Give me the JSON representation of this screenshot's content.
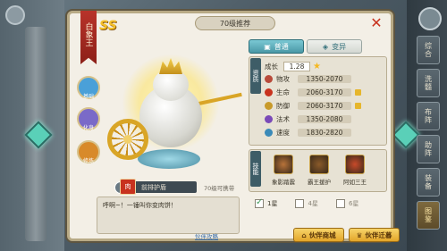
{
  "window": {
    "title": "70级推荐",
    "close_symbol": "✕"
  },
  "hero": {
    "name": "白象王",
    "rank": "SS",
    "skills_left": [
      {
        "label": "基础",
        "icon": "shield-icon",
        "color": "#4aa0d8"
      },
      {
        "label": "化身",
        "icon": "avatar-icon",
        "color": "#7a6ac8"
      },
      {
        "label": "修炼",
        "icon": "flame-icon",
        "color": "#d88a2a"
      }
    ],
    "position_tag": "肉",
    "role_label": "前排护盾",
    "level_note": "70级可携带",
    "quote": "呼啊~！一锤叫你变肉饼！",
    "quote_link": "伙伴攻略"
  },
  "tabs": [
    {
      "label": "普通",
      "icon": "book-icon"
    },
    {
      "label": "变异",
      "icon": "mutation-icon"
    }
  ],
  "stats": {
    "section_label": "资质",
    "growth_label": "成长",
    "growth_value": "1.28",
    "rows": [
      {
        "label": "物攻",
        "value": "1350-2070",
        "color": "#b84a3a",
        "mark": false
      },
      {
        "label": "生命",
        "value": "2060-3170",
        "color": "#c8321e",
        "mark": true
      },
      {
        "label": "防御",
        "value": "2060-3170",
        "color": "#c89a2a",
        "mark": true
      },
      {
        "label": "法术",
        "value": "1350-2080",
        "color": "#7a4ab8",
        "mark": false
      },
      {
        "label": "速度",
        "value": "1830-2820",
        "color": "#3a8ab8",
        "mark": false
      }
    ]
  },
  "skills": {
    "section_label": "技能",
    "items": [
      {
        "name": "象影踏震",
        "color": "#b8733a"
      },
      {
        "name": "霸王援护",
        "color": "#8a5a2a"
      },
      {
        "name": "阿如三王",
        "color": "#c84a2a"
      }
    ]
  },
  "star_options": [
    {
      "label": "1星",
      "checked": true
    },
    {
      "label": "4星",
      "checked": false
    },
    {
      "label": "6星",
      "checked": false
    }
  ],
  "buttons": {
    "shop": "伙伴商城",
    "rank": "伙伴迁暮"
  },
  "right_tabs": [
    {
      "label": "综合",
      "active": false
    },
    {
      "label": "洗髓",
      "active": false
    },
    {
      "label": "布阵",
      "active": false
    },
    {
      "label": "助阵",
      "active": false
    },
    {
      "label": "装备",
      "active": false
    },
    {
      "label": "图鉴",
      "active": true
    }
  ],
  "colors": {
    "accent": "#c8321e",
    "gold": "#f5c02a",
    "teal": "#4a98a6"
  }
}
